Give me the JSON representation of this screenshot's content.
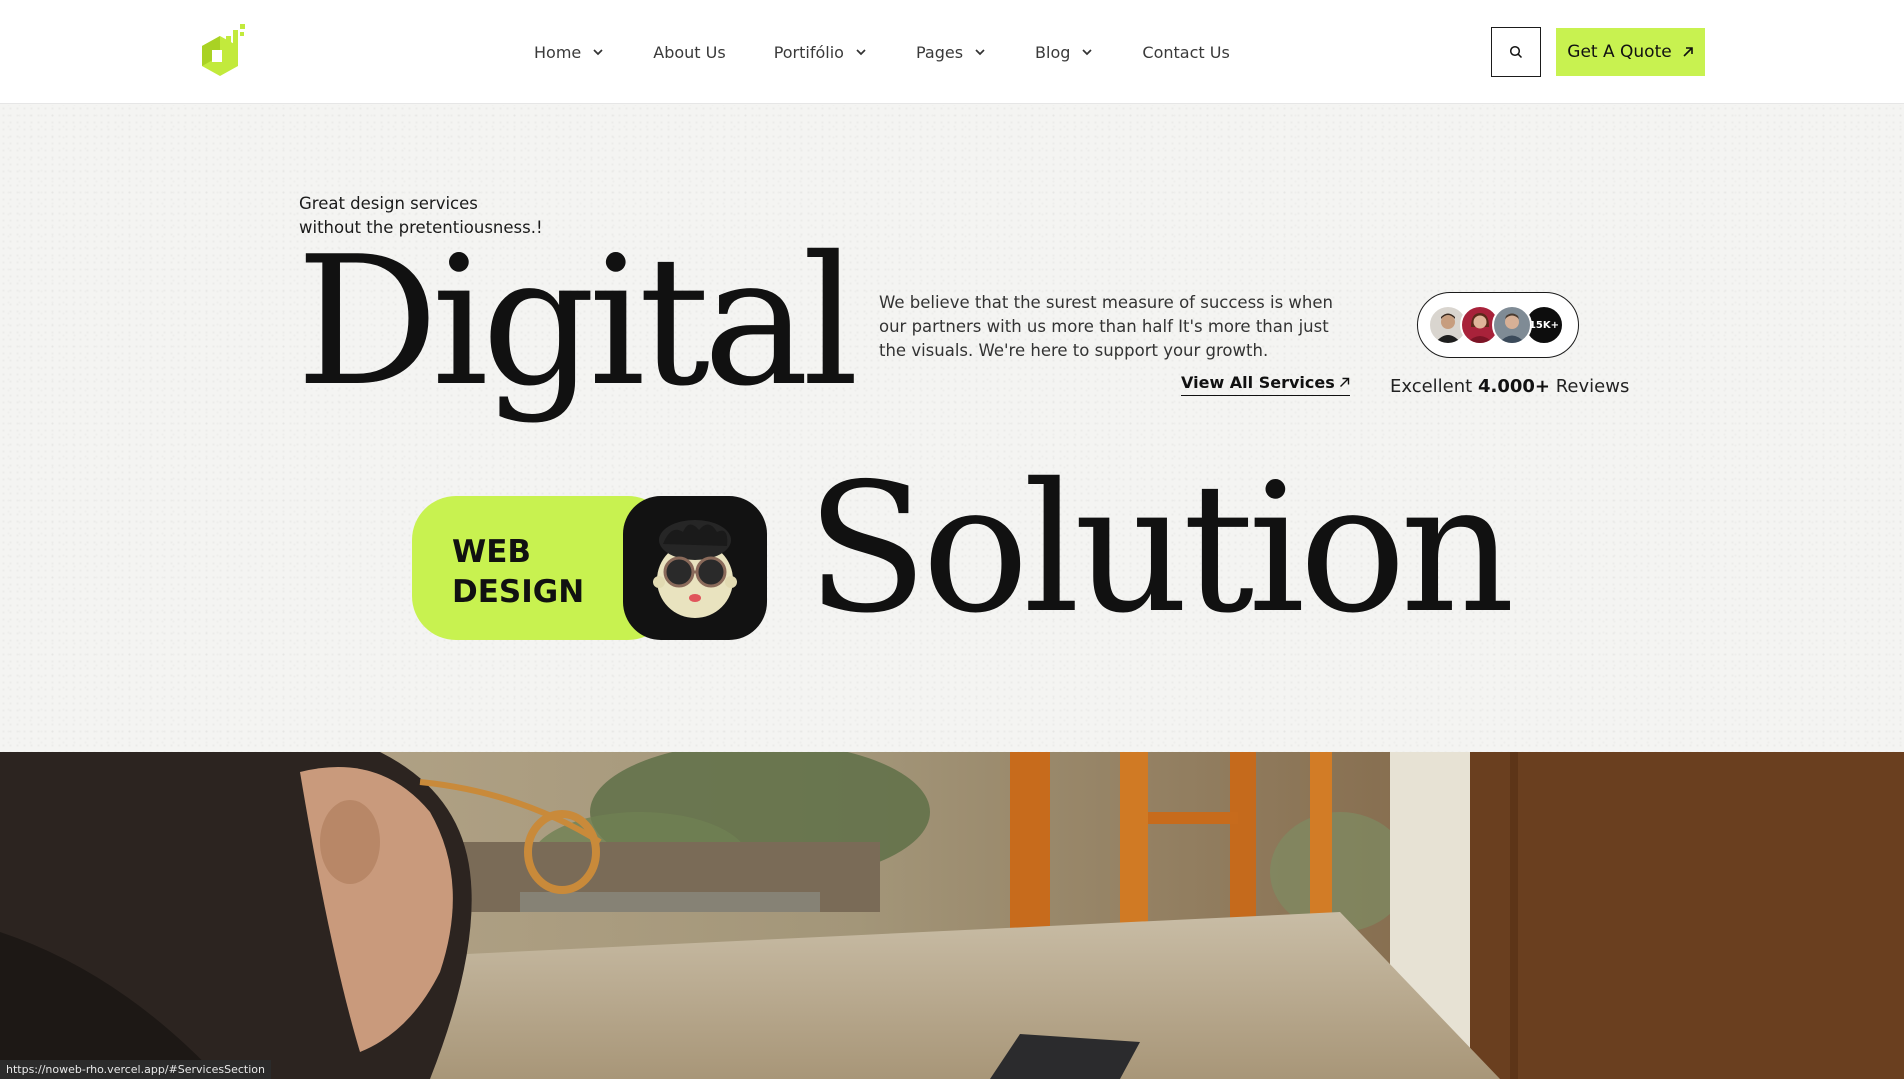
{
  "header": {
    "logo_icon": "brand-logo-icon",
    "nav": [
      {
        "label": "Home",
        "has_dropdown": true
      },
      {
        "label": "About Us",
        "has_dropdown": false
      },
      {
        "label": "Portifólio",
        "has_dropdown": true
      },
      {
        "label": "Pages",
        "has_dropdown": true
      },
      {
        "label": "Blog",
        "has_dropdown": true
      },
      {
        "label": "Contact Us",
        "has_dropdown": false
      }
    ],
    "search_icon": "search-icon",
    "cta_label": "Get A Quote",
    "cta_icon": "arrow-up-right-icon"
  },
  "hero": {
    "tagline_line1": "Great design services",
    "tagline_line2": "without the pretentiousness.!",
    "headline_word1": "Digital",
    "headline_word2": "Solution",
    "description": "We believe that the surest measure of success is when our partners with us more than half It's more than just the visuals. We're here to support your growth.",
    "services_link": "View All Services",
    "reviews_count_badge": "15K+",
    "reviews_prefix": "Excellent",
    "reviews_number": "4.000+",
    "reviews_suffix": "Reviews",
    "pill_line1": "WEB",
    "pill_line2": "DESIGN"
  },
  "status_bar": {
    "url": "https://noweb-rho.vercel.app/#ServicesSection"
  },
  "colors": {
    "accent": "#c8f250",
    "text": "#111111",
    "background": "#f4f4f2"
  }
}
